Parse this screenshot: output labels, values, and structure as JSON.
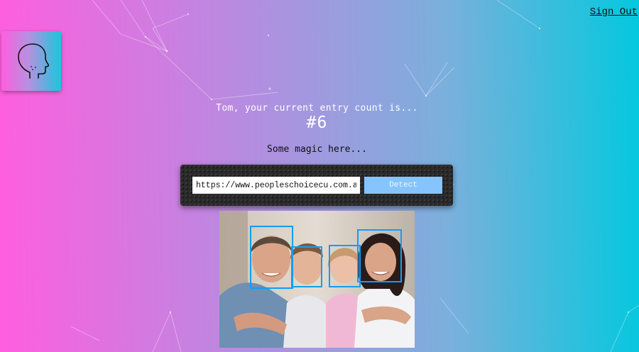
{
  "header": {
    "signout_label": "Sign Out"
  },
  "logo": {
    "icon": "head-profile-icon"
  },
  "main": {
    "entry_text": "Tom, your current entry count is...",
    "entry_count": "#6",
    "tagline": "Some magic here...",
    "url_input": {
      "value": "https://www.peopleschoicecu.com.au/content/dam/pccu/images/family.jpg"
    },
    "detect_label": "Detect"
  },
  "photo": {
    "subject": "family photo with detected faces",
    "face_count": 4
  },
  "colors": {
    "gradient_start": "#ff5edf",
    "gradient_end": "#04c8de",
    "face_box": "#149df2",
    "detect_button": "#86c4ff"
  }
}
